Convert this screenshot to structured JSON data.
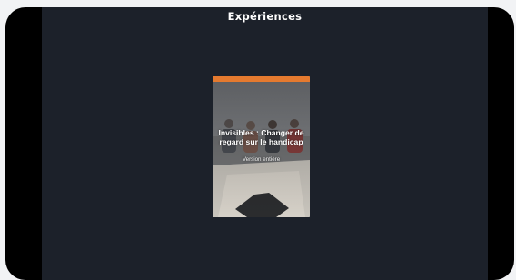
{
  "page": {
    "title": "Expériences"
  },
  "card": {
    "title": "Invisibles : Changer de regard sur le handicap",
    "subtitle": "Version entière",
    "accent_color": "#e57a2f"
  }
}
